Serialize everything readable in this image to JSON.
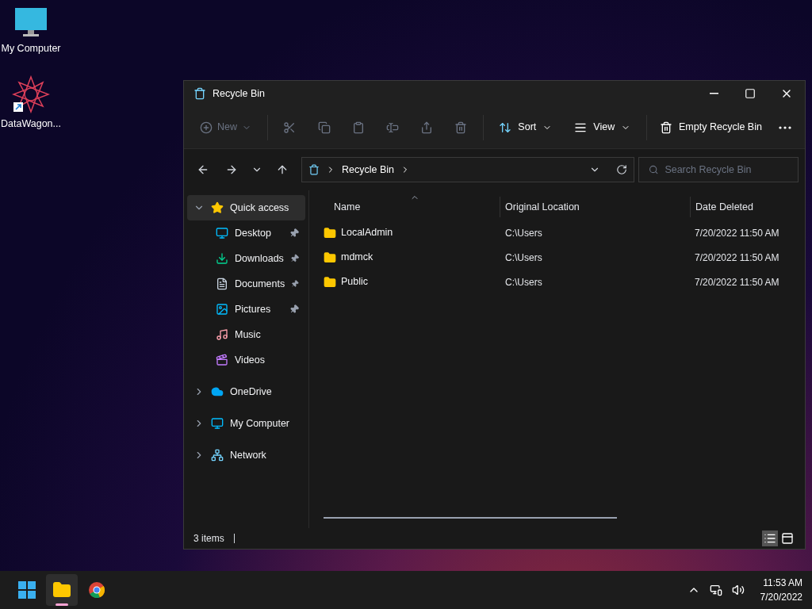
{
  "desktop_icons": [
    {
      "label": "My Computer",
      "kind": "computer"
    },
    {
      "label": "DataWagon...",
      "kind": "shortcut"
    }
  ],
  "window": {
    "title": "Recycle Bin"
  },
  "toolbar": {
    "new_button": {
      "label": "New",
      "disabled": true
    },
    "actions": [
      {
        "kind": "cut",
        "disabled": true
      },
      {
        "kind": "copy",
        "disabled": true
      },
      {
        "kind": "paste",
        "disabled": true
      },
      {
        "kind": "rename",
        "disabled": true
      },
      {
        "kind": "share",
        "disabled": true
      },
      {
        "kind": "delete",
        "disabled": true
      }
    ],
    "sort_button": "Sort",
    "view_button": "View",
    "empty_button": "Empty Recycle Bin"
  },
  "address_bar": {
    "crumbs": [
      "Recycle Bin"
    ]
  },
  "search": {
    "placeholder": "Search Recycle Bin"
  },
  "sidebar": {
    "items": [
      {
        "label": "Quick access",
        "kind": "star",
        "expanded": true,
        "selected": true,
        "children": [
          {
            "label": "Desktop",
            "kind": "desktop",
            "pinned": true,
            "selected": false
          },
          {
            "label": "Downloads",
            "kind": "downloads",
            "pinned": true,
            "selected": false
          },
          {
            "label": "Documents",
            "kind": "documents",
            "pinned": true,
            "selected": false
          },
          {
            "label": "Pictures",
            "kind": "pictures",
            "pinned": true,
            "selected": false
          },
          {
            "label": "Music",
            "kind": "music",
            "pinned": false,
            "selected": false
          },
          {
            "label": "Videos",
            "kind": "videos",
            "pinned": false,
            "selected": false
          }
        ]
      },
      {
        "label": "OneDrive",
        "kind": "cloud",
        "expanded": false,
        "selected": false
      },
      {
        "label": "My Computer",
        "kind": "computer",
        "expanded": false,
        "selected": false
      },
      {
        "label": "Network",
        "kind": "network",
        "expanded": false,
        "selected": false
      }
    ]
  },
  "table": {
    "columns": [
      "Name",
      "Original Location",
      "Date Deleted"
    ],
    "rows": [
      {
        "name": "LocalAdmin",
        "location": "C:\\Users",
        "date": "7/20/2022 11:50 AM"
      },
      {
        "name": "mdmck",
        "location": "C:\\Users",
        "date": "7/20/2022 11:50 AM"
      },
      {
        "name": "Public",
        "location": "C:\\Users",
        "date": "7/20/2022 11:50 AM"
      }
    ]
  },
  "status_bar": {
    "item_count": "3 items",
    "views": [
      {
        "kind": "details",
        "selected": true
      },
      {
        "kind": "tiles",
        "selected": false
      }
    ]
  },
  "taskbar": {
    "apps": [
      {
        "kind": "start",
        "selected": false
      },
      {
        "kind": "explorer",
        "selected": true
      },
      {
        "kind": "browser",
        "selected": false
      }
    ],
    "time": "11:53 AM",
    "date": "7/20/2022"
  }
}
